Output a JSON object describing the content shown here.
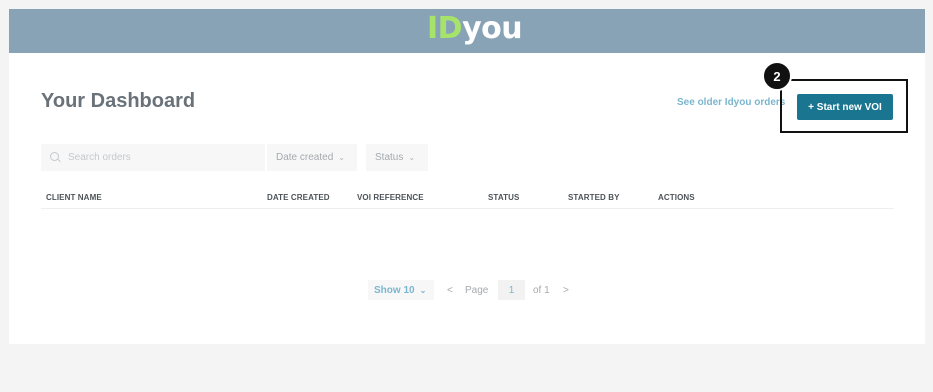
{
  "logo": {
    "id": "ID",
    "you": "you"
  },
  "dashboard": {
    "title": "Your Dashboard"
  },
  "links": {
    "older_orders": "See older Idyou orders"
  },
  "actions": {
    "start_new": "+ Start new VOI"
  },
  "annotation": {
    "step": "2"
  },
  "filters": {
    "search_placeholder": "Search orders",
    "date_created": "Date created",
    "status": "Status"
  },
  "table": {
    "columns": [
      "CLIENT NAME",
      "DATE CREATED",
      "VOI REFERENCE",
      "STATUS",
      "STARTED BY",
      "ACTIONS"
    ]
  },
  "pagination": {
    "show": "Show 10",
    "page_label": "Page",
    "page": "1",
    "of": "of 1",
    "prev": "<",
    "next": ">"
  },
  "icons": {
    "search": "search-icon",
    "chevron": "chevron-down-icon"
  },
  "colors": {
    "header": "#89a3b6",
    "accent": "#1a7690",
    "link": "#7bb6cf",
    "logo_green": "#a6e36b"
  }
}
